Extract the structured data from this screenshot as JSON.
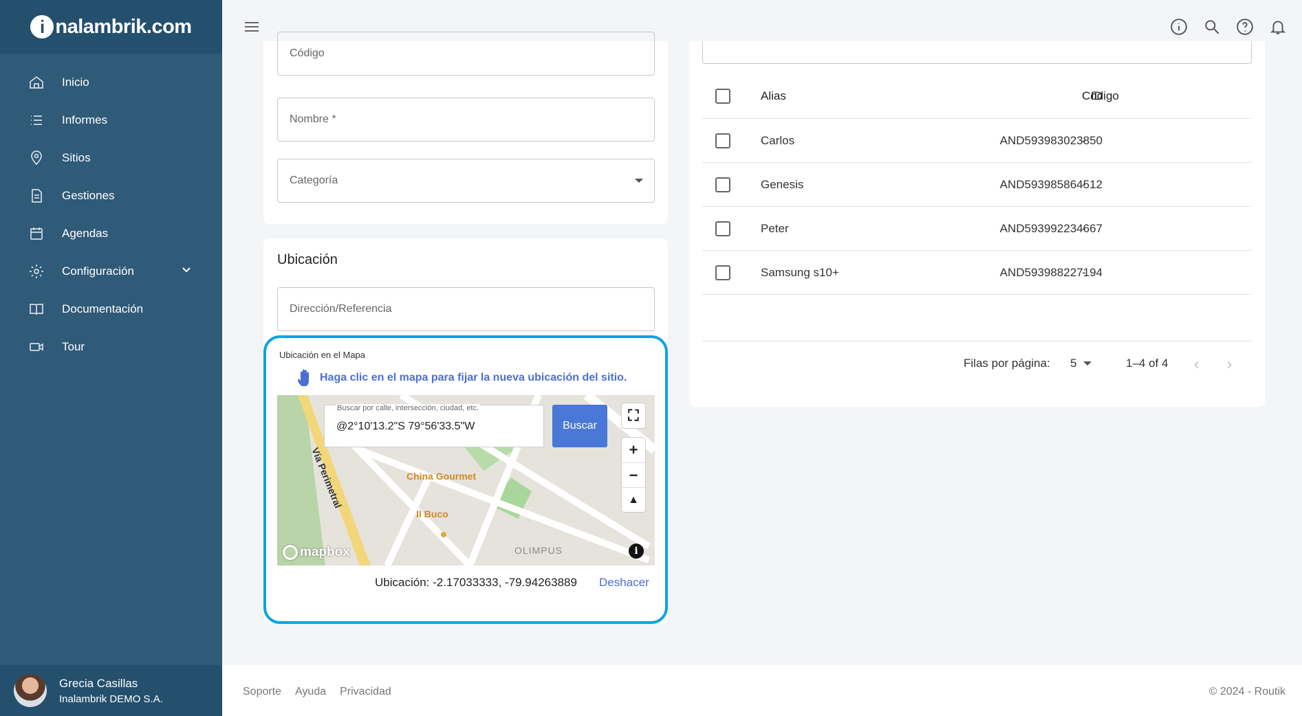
{
  "brand": {
    "logo_letter": "i",
    "name_rest": "nalambrik.com"
  },
  "sidebar": {
    "items": [
      {
        "label": "Inicio",
        "icon": "home-icon"
      },
      {
        "label": "Informes",
        "icon": "list-icon"
      },
      {
        "label": "Sitios",
        "icon": "location-pin-icon"
      },
      {
        "label": "Gestiones",
        "icon": "document-icon"
      },
      {
        "label": "Agendas",
        "icon": "calendar-icon"
      },
      {
        "label": "Configuración",
        "icon": "gear-icon"
      },
      {
        "label": "Documentación",
        "icon": "book-icon"
      },
      {
        "label": "Tour",
        "icon": "video-camera-icon"
      }
    ],
    "user": {
      "name": "Grecia Casillas",
      "org": "Inalambrik DEMO S.A."
    }
  },
  "form": {
    "codigo_label": "Código",
    "nombre_label": "Nombre *",
    "categoria_label": "Categoría"
  },
  "ubicacion": {
    "title": "Ubicación",
    "direccion_label": "Dirección/Referencia",
    "map_label": "Ubicación en el Mapa",
    "hint": "Haga clic en el mapa para fijar la nueva ubicación del sitio.",
    "search_placeholder": "Buscar por calle, intersección, ciudad, etc.",
    "search_value": "@2°10'13.2\"S 79°56'33.5\"W",
    "search_button": "Buscar",
    "map_labels": {
      "road": "Vía Perimetral",
      "poi1": "China Gourmet",
      "poi2": "Il Buco",
      "area": "OLIMPUS",
      "attribution": "mapbox"
    },
    "location_text": "Ubicación: -2.17033333, -79.94263889",
    "undo": "Deshacer"
  },
  "table": {
    "headers": {
      "alias": "Alias",
      "id": "ID",
      "codigo": "Código"
    },
    "rows": [
      {
        "alias": "Carlos",
        "id": "AND593983023850",
        "codigo": "-"
      },
      {
        "alias": "Genesis",
        "id": "AND593985864512",
        "codigo": "-"
      },
      {
        "alias": "Peter",
        "id": "AND593992234667",
        "codigo": "-"
      },
      {
        "alias": "Samsung s10+",
        "id": "AND593988227194",
        "codigo": "-"
      }
    ],
    "pagination": {
      "rows_label": "Filas por página:",
      "rows_value": "5",
      "range": "1–4 of 4"
    }
  },
  "footer": {
    "links": [
      "Soporte",
      "Ayuda",
      "Privacidad"
    ],
    "copyright": "© 2024 - Routik"
  },
  "colors": {
    "sidebar": "#2f5a78",
    "accent": "#4a6fd6",
    "highlight": "#0aa5e0"
  }
}
